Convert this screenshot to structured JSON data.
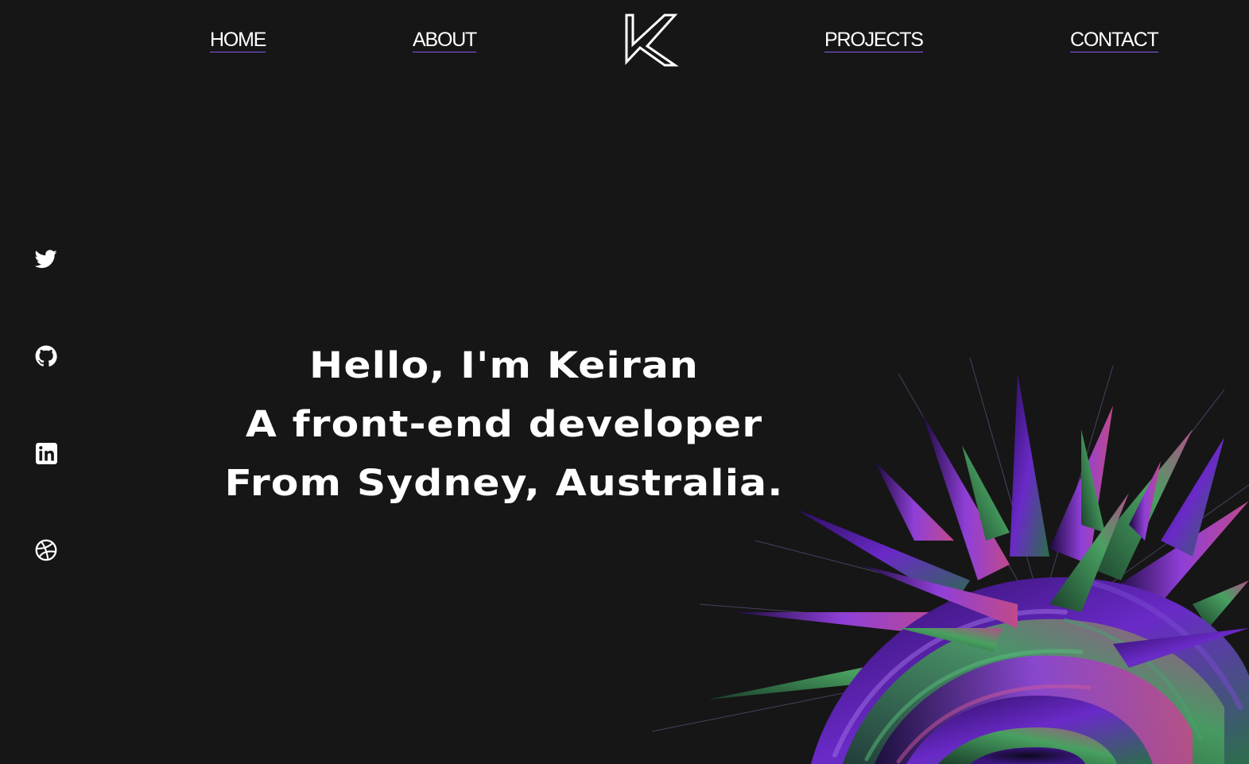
{
  "nav": {
    "home": "HOME",
    "about": "ABOUT",
    "projects": "PROJECTS",
    "contact": "CONTACT"
  },
  "logo": {
    "icon": "k-monogram-logo"
  },
  "social": [
    {
      "icon": "twitter-icon"
    },
    {
      "icon": "github-icon"
    },
    {
      "icon": "linkedin-icon"
    },
    {
      "icon": "dribbble-icon"
    }
  ],
  "hero": {
    "line1": "Hello, I'm Keiran",
    "line2": "A front-end developer",
    "line3": "From Sydney, Australia."
  },
  "colors": {
    "background": "#161616",
    "text": "#ffffff",
    "underline": "#8a5cf6",
    "art_purple": "#5a1fb0",
    "art_green": "#3c8a4c",
    "art_pink": "#b8407a"
  }
}
